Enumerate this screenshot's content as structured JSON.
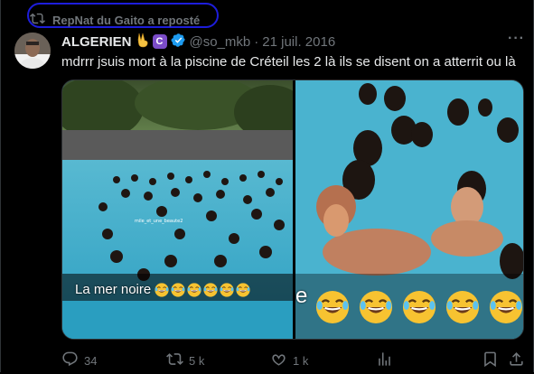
{
  "repost": {
    "icon": "repost-icon",
    "text": "RepNat du Gaito a reposté"
  },
  "author": {
    "display_name": "ALGERIEN",
    "badges": [
      "victory-hand-emoji",
      "purple-org-badge",
      "blue-verified-badge"
    ],
    "handle": "@so_mkb",
    "separator": "·",
    "date": "21 juil. 2016"
  },
  "more_label": "···",
  "post_text": "mdrrr jsuis mort à la piscine de Créteil les 2 là ils se disent on a atterrit ou là",
  "media": {
    "left_caption": "La mer noire",
    "left_watermark": "mile_et_une_beaute2",
    "left_emoji_count": 6,
    "right_caption_letter": "e",
    "right_emoji_count": 5,
    "emoji_name": "face-with-tears-of-joy"
  },
  "actions": {
    "reply_count": "34",
    "repost_count": "5 k",
    "like_count": "1 k",
    "icons": [
      "reply-icon",
      "repost-icon",
      "like-icon",
      "views-icon",
      "bookmark-icon",
      "share-icon"
    ]
  },
  "colors": {
    "background": "#000000",
    "muted": "#71767b",
    "text": "#e7e9ea",
    "verified": "#1d9bf0",
    "annotation_ring": "#1d1ddb"
  }
}
